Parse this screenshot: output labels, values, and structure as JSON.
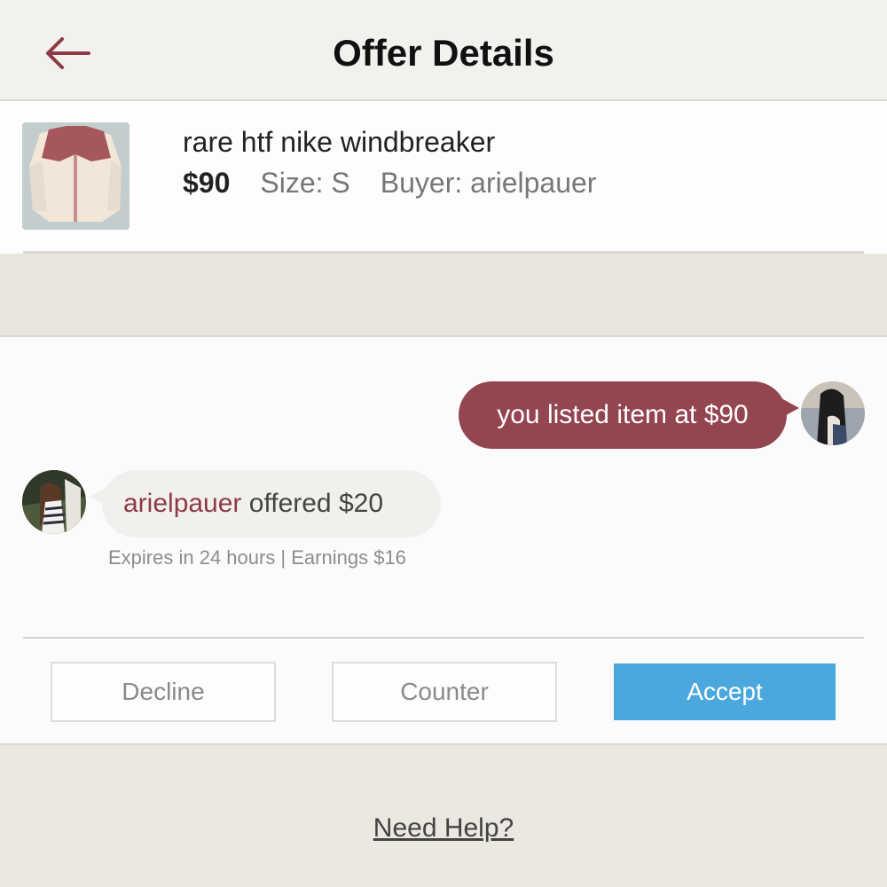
{
  "header": {
    "title": "Offer Details",
    "back_icon": "arrow-left-icon",
    "accent_color": "#8e3a45"
  },
  "item": {
    "title": "rare htf nike windbreaker",
    "price": "$90",
    "size": "Size: S",
    "buyer": "Buyer: arielpauer"
  },
  "conversation": {
    "seller_message": "you listed item at $90",
    "buyer_name": "arielpauer",
    "buyer_offer": " offered $20",
    "offer_info": "Expires in 24 hours | Earnings $16"
  },
  "actions": {
    "decline": "Decline",
    "counter": "Counter",
    "accept": "Accept",
    "accept_color": "#4aa8dd"
  },
  "footer": {
    "help": "Need Help?"
  }
}
